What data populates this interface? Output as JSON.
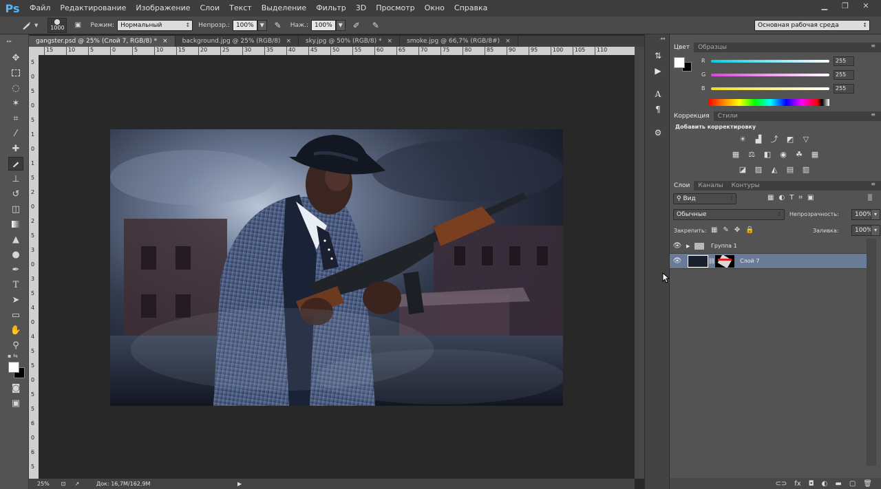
{
  "app": {
    "logo": "Ps"
  },
  "menu": [
    "Файл",
    "Редактирование",
    "Изображение",
    "Слои",
    "Текст",
    "Выделение",
    "Фильтр",
    "3D",
    "Просмотр",
    "Окно",
    "Справка"
  ],
  "window_buttons": {
    "minimize": "▁",
    "restore": "❐",
    "close": "✕"
  },
  "options": {
    "brush_size": "1000",
    "mode_label": "Режим:",
    "mode_value": "Нормальный",
    "opacity_label": "Непрозр.:",
    "opacity_value": "100%",
    "pressure_label": "Наж.:",
    "pressure_value": "100%",
    "workspace": "Основная рабочая среда"
  },
  "tabs": [
    {
      "label": "gangster.psd @ 25% (Слой 7, RGB/8) *",
      "close": "×"
    },
    {
      "label": "background.jpg @ 25% (RGB/8)",
      "close": "×"
    },
    {
      "label": "sky.jpg @ 50% (RGB/8) *",
      "close": "×"
    },
    {
      "label": "smoke.jpg @ 66,7% (RGB/8#)",
      "close": "×"
    }
  ],
  "ruler": {
    "h_labels": [
      "15",
      "10",
      "5",
      "0",
      "5",
      "10",
      "15",
      "20",
      "25",
      "30",
      "35",
      "40",
      "45",
      "50",
      "55",
      "60",
      "65",
      "70",
      "75",
      "80",
      "85",
      "90",
      "95",
      "100",
      "105",
      "110"
    ],
    "v_labels": [
      "5",
      "0",
      "5",
      "0",
      "5",
      "1",
      "0",
      "1",
      "5",
      "2",
      "0",
      "2",
      "5",
      "3",
      "0",
      "3",
      "5",
      "4",
      "0",
      "4",
      "5",
      "5",
      "0",
      "5",
      "5",
      "6",
      "0",
      "6",
      "5"
    ]
  },
  "status": {
    "zoom": "25%",
    "doc": "Док: 16,7M/162,9M"
  },
  "color_panel": {
    "tabs": [
      "Цвет",
      "Образцы"
    ],
    "channels": [
      {
        "name": "R",
        "value": "255",
        "color": "#00d0e8"
      },
      {
        "name": "G",
        "value": "255",
        "color": "#e040e0"
      },
      {
        "name": "B",
        "value": "255",
        "color": "#f0e020"
      }
    ]
  },
  "adjust_panel": {
    "tabs": [
      "Коррекция",
      "Стили"
    ],
    "title": "Добавить корректировку",
    "row1": [
      "brightness-icon",
      "levels-icon",
      "curves-icon",
      "exposure-icon",
      "vibrance-icon"
    ],
    "row2": [
      "hue-sat-icon",
      "color-balance-icon",
      "bw-icon",
      "photo-filter-icon",
      "channel-mixer-icon",
      "color-lookup-icon"
    ],
    "row3": [
      "invert-icon",
      "posterize-icon",
      "threshold-icon",
      "selective-color-icon",
      "gradient-map-icon"
    ]
  },
  "layers_panel": {
    "tabs": [
      "Слои",
      "Каналы",
      "Контуры"
    ],
    "kind_filter": "Вид",
    "blend_mode": "Обычные",
    "opacity_label": "Непрозрачность:",
    "opacity_value": "100%",
    "lock_label": "Закрепить:",
    "fill_label": "Заливка:",
    "fill_value": "100%",
    "layers": [
      {
        "name": "Группа 1",
        "type": "group",
        "selected": false
      },
      {
        "name": "Слой 7",
        "type": "layer",
        "selected": true
      }
    ],
    "footer_icons": [
      "link-icon",
      "fx-icon",
      "mask-icon",
      "adjustment-icon",
      "folder-icon",
      "new-layer-icon",
      "trash-icon"
    ]
  },
  "colors": {
    "accent": "#4fb7ff",
    "selected_layer": "#6a7b98"
  }
}
